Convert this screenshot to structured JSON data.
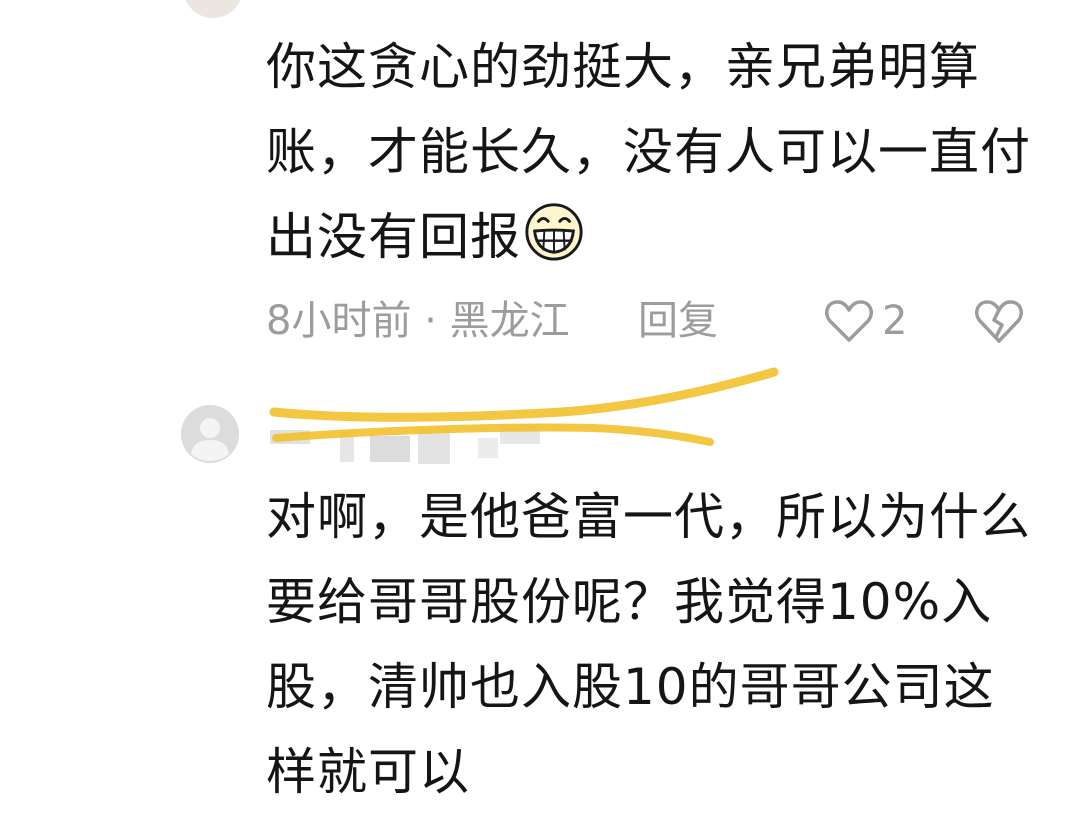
{
  "comments": [
    {
      "author_partial": "",
      "text": "你这贪心的劲挺大，亲兄弟明算\n账，才能长久，没有人可以一直付\n出没有回报",
      "time": "8小时前",
      "location": "黑龙江",
      "meta": "8小时前 · 黑龙江",
      "reply_label": "回复",
      "like_count": "2",
      "emoji_icon": "grinning-face-icon"
    },
    {
      "author_partial": "",
      "text": "对啊，是他爸富一代，所以为什么\n要给哥哥股份呢？我觉得10%入\n股，清帅也入股10的哥哥公司这\n样就可以",
      "avatar_icon": "default-avatar-icon"
    }
  ],
  "colors": {
    "text": "#151515",
    "meta": "#9c9c9c",
    "scribble": "#f2c12e",
    "avatar_bg": "#dcdcdc"
  }
}
